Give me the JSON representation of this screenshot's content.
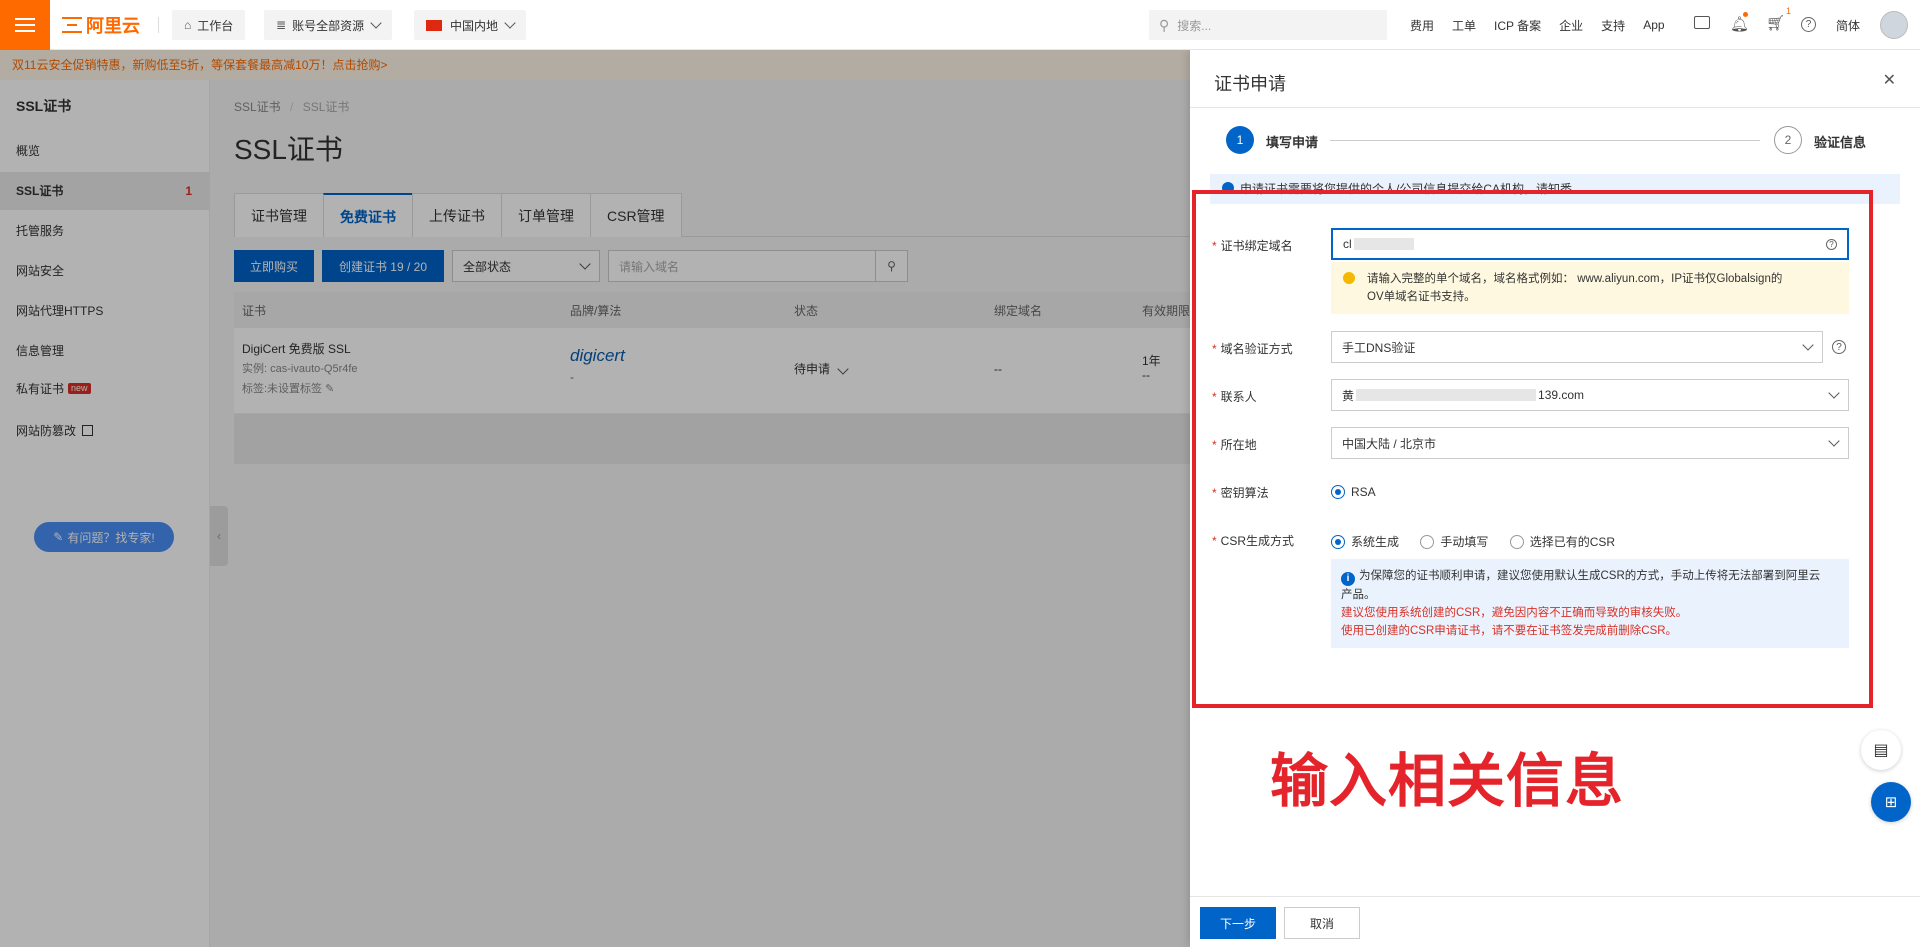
{
  "topbar": {
    "brand": "阿里云",
    "workbench": "工作台",
    "resources": "账号全部资源",
    "region": "中国内地",
    "search_placeholder": "搜索...",
    "nav": [
      "费用",
      "工单",
      "ICP 备案",
      "企业",
      "支持",
      "App"
    ],
    "cart_count": "1",
    "language": "简体",
    "icons": [
      "terminal-icon",
      "bell-icon",
      "cart-icon",
      "help-icon"
    ]
  },
  "promo": "双11云安全促销特惠，新购低至5折，等保套餐最高减10万！点击抢购>",
  "sidebar": {
    "title": "SSL证书",
    "items": [
      {
        "label": "概览"
      },
      {
        "label": "SSL证书",
        "count": "1"
      },
      {
        "label": "托管服务"
      },
      {
        "label": "网站安全"
      },
      {
        "label": "网站代理HTTPS"
      },
      {
        "label": "信息管理"
      },
      {
        "label": "私有证书",
        "badge": "new"
      },
      {
        "label": "网站防篡改"
      }
    ],
    "help": "有问题？找专家!"
  },
  "main": {
    "breadcrumb": [
      "SSL证书",
      "/",
      "SSL证书"
    ],
    "title": "SSL证书",
    "tabs": [
      "证书管理",
      "免费证书",
      "上传证书",
      "订单管理",
      "CSR管理"
    ],
    "buy_label": "立即购买",
    "create_label": "创建证书 19 / 20",
    "status_filter": "全部状态",
    "domain_placeholder": "请输入域名",
    "columns": [
      "证书",
      "品牌/算法",
      "状态",
      "绑定域名",
      "有效期限"
    ],
    "row": {
      "name": "DigiCert 免费版 SSL",
      "instance": "实例: cas-ivauto-Q5r4fe",
      "tags": "标签:未设置标签",
      "brand": "digicert",
      "algo": "-",
      "status": "待申请",
      "domain": "--",
      "validity": "1年",
      "validity_sub": "--"
    }
  },
  "drawer": {
    "title": "证书申请",
    "steps": [
      {
        "num": "1",
        "label": "填写申请"
      },
      {
        "num": "2",
        "label": "验证信息"
      }
    ],
    "notice": "申请证书需要将您提供的个人/公司信息提交给CA机构，请知悉。",
    "fields": {
      "domain": {
        "label": "证书绑定域名",
        "value": "cl"
      },
      "domain_hint_1": "请输入完整的单个域名，域名格式例如： www.aliyun.com，IP证书仅Globalsign的",
      "domain_hint_2": "OV单域名证书支持。",
      "verify": {
        "label": "域名验证方式",
        "value": "手工DNS验证"
      },
      "contact": {
        "label": "联系人",
        "value_prefix": "黄",
        "value_suffix": "139.com"
      },
      "location": {
        "label": "所在地",
        "value": "中国大陆 / 北京市"
      },
      "algorithm": {
        "label": "密钥算法",
        "option": "RSA"
      },
      "csr": {
        "label": "CSR生成方式",
        "options": [
          "系统生成",
          "手动填写",
          "选择已有的CSR"
        ]
      }
    },
    "csr_info_1": "为保障您的证书顺利申请，建议您使用默认生成CSR的方式，手动上传将无法部署到阿里云",
    "csr_info_2": "产品。",
    "csr_warn_1": "建议您使用系统创建的CSR，避免因内容不正确而导致的审核失败。",
    "csr_warn_2": "使用已创建的CSR申请证书，请不要在证书签发完成前删除CSR。",
    "annotation": "输入相关信息",
    "next_label": "下一步",
    "cancel_label": "取消"
  },
  "colors": {
    "brand": "#ff6a00",
    "primary": "#0064c8",
    "annotation": "#e5232b"
  }
}
